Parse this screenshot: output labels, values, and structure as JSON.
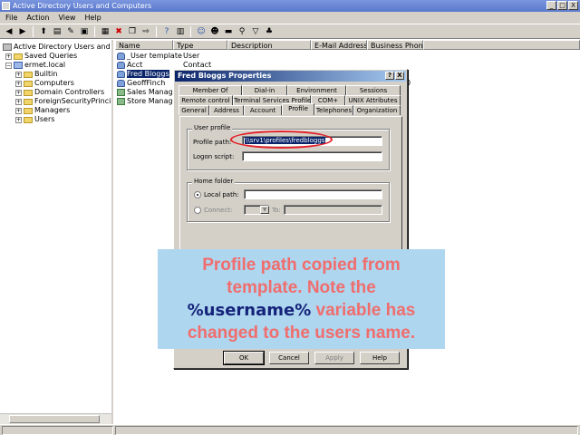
{
  "window": {
    "title": "Active Directory Users and Computers",
    "controls": [
      "_",
      "□",
      "X"
    ]
  },
  "menubar": [
    "File",
    "Action",
    "View",
    "Help"
  ],
  "toolbar": {
    "buttons": [
      "back-icon",
      "forward-icon",
      "up-folder-icon",
      "details-icon",
      "refresh-icon",
      "export-icon",
      "properties-icon",
      "delete-icon",
      "copy-icon",
      "help-icon",
      "new-user-icon",
      "new-group-icon",
      "new-ou-icon",
      "filter-icon",
      "find-icon",
      "add-to-group-icon"
    ]
  },
  "tree": {
    "items": [
      {
        "label": "Active Directory Users and Compu",
        "level": 0,
        "expander": "",
        "icon": "root"
      },
      {
        "label": "Saved Queries",
        "level": 1,
        "expander": "+",
        "icon": "folder"
      },
      {
        "label": "ermet.local",
        "level": 1,
        "expander": "−",
        "icon": "domain"
      },
      {
        "label": "Builtin",
        "level": 2,
        "expander": "+",
        "icon": "folder"
      },
      {
        "label": "Computers",
        "level": 2,
        "expander": "+",
        "icon": "folder"
      },
      {
        "label": "Domain Controllers",
        "level": 2,
        "expander": "+",
        "icon": "folder"
      },
      {
        "label": "ForeignSecurityPrincipals",
        "level": 2,
        "expander": "+",
        "icon": "folder"
      },
      {
        "label": "Managers",
        "level": 2,
        "expander": "+",
        "icon": "folder"
      },
      {
        "label": "Users",
        "level": 2,
        "expander": "+",
        "icon": "folder"
      }
    ]
  },
  "list": {
    "columns": [
      "Name",
      "Type",
      "Description",
      "E-Mail Address",
      "Business Phone"
    ],
    "rows": [
      {
        "name": "_User template",
        "type": "User",
        "icon": "user",
        "selected": false
      },
      {
        "name": "Acct",
        "type": "Contact",
        "icon": "user",
        "selected": false
      },
      {
        "name": "Fred Bloggs",
        "type": "User",
        "icon": "user",
        "selected": true
      },
      {
        "name": "GeoffFinch",
        "type": "User",
        "icon": "user",
        "selected": false
      },
      {
        "name": "Sales Managers",
        "type": "",
        "icon": "group",
        "selected": false
      },
      {
        "name": "Store Managers",
        "type": "",
        "icon": "group",
        "selected": false
      }
    ],
    "partial_phone": "0"
  },
  "dialog": {
    "title": "Fred Bloggs Properties",
    "title_buttons": [
      "?",
      "X"
    ],
    "tabs_row1": [
      "Member Of",
      "Dial-in",
      "Environment",
      "Sessions"
    ],
    "tabs_row2": [
      "Remote control",
      "Terminal Services Profile",
      "COM+",
      "UNIX Attributes"
    ],
    "tabs_row3": [
      "General",
      "Address",
      "Account",
      "Profile",
      "Telephones",
      "Organization"
    ],
    "active_tab": "Profile",
    "user_profile": {
      "group_label": "User profile",
      "profile_path_label": "Profile path:",
      "profile_path_value": "\\\\srv1\\profiles\\fredbloggs",
      "logon_script_label": "Logon script:",
      "logon_script_value": ""
    },
    "home_folder": {
      "group_label": "Home folder",
      "local_path_label": "Local path:",
      "local_path_value": "",
      "connect_label": "Connect:",
      "to_label": "To:",
      "local_path_selected": true
    },
    "buttons": {
      "ok": "OK",
      "cancel": "Cancel",
      "apply": "Apply",
      "help": "Help"
    }
  },
  "callout": {
    "line1": "Profile path copied from template. Note the",
    "variable": "%username%",
    "line2": "variable has changed to the users name."
  }
}
